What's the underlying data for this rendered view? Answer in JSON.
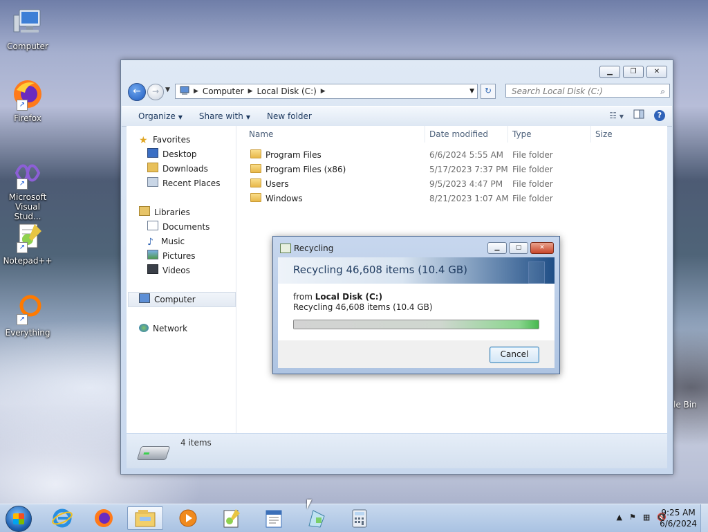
{
  "desktop": {
    "icons": [
      {
        "label": "Computer",
        "icon": "computer-icon"
      },
      {
        "label": "Firefox",
        "icon": "firefox-icon"
      },
      {
        "label": "Microsoft Visual Stud...",
        "icon": "visual-studio-icon"
      },
      {
        "label": "Notepad++",
        "icon": "notepadpp-icon"
      },
      {
        "label": "Everything",
        "icon": "everything-icon"
      }
    ],
    "recycle_bin_label": "le Bin"
  },
  "explorer": {
    "address": {
      "crumbs": [
        "Computer",
        "Local Disk (C:)"
      ]
    },
    "search_placeholder": "Search Local Disk (C:)",
    "toolbar": {
      "organize": "Organize",
      "share_with": "Share with",
      "new_folder": "New folder"
    },
    "nav": {
      "favorites": "Favorites",
      "desktop": "Desktop",
      "downloads": "Downloads",
      "recent_places": "Recent Places",
      "libraries": "Libraries",
      "documents": "Documents",
      "music": "Music",
      "pictures": "Pictures",
      "videos": "Videos",
      "computer": "Computer",
      "network": "Network"
    },
    "columns": {
      "name": "Name",
      "date_modified": "Date modified",
      "type": "Type",
      "size": "Size"
    },
    "files": [
      {
        "name": "Program Files",
        "date": "6/6/2024 5:55 AM",
        "type": "File folder"
      },
      {
        "name": "Program Files (x86)",
        "date": "5/17/2023 7:37 PM",
        "type": "File folder"
      },
      {
        "name": "Users",
        "date": "9/5/2023 4:47 PM",
        "type": "File folder"
      },
      {
        "name": "Windows",
        "date": "8/21/2023 1:07 AM",
        "type": "File folder"
      }
    ],
    "status": "4 items"
  },
  "dialog": {
    "title": "Recycling",
    "header": "Recycling 46,608 items (10.4 GB)",
    "from_prefix": "from ",
    "from_location": "Local Disk (C:)",
    "detail": "Recycling 46,608 items (10.4 GB)",
    "progress": 1.0,
    "cancel": "Cancel"
  },
  "taskbar": {
    "apps": [
      "internet-explorer-icon",
      "firefox-icon",
      "file-explorer-icon",
      "media-player-icon",
      "notepadpp-icon",
      "wordpad-icon",
      "paint-icon",
      "calculator-icon"
    ],
    "time": "9:25 AM",
    "date": "6/6/2024"
  },
  "colors": {
    "accent": "#1f5cc0",
    "progress_green": "#47b84f"
  }
}
